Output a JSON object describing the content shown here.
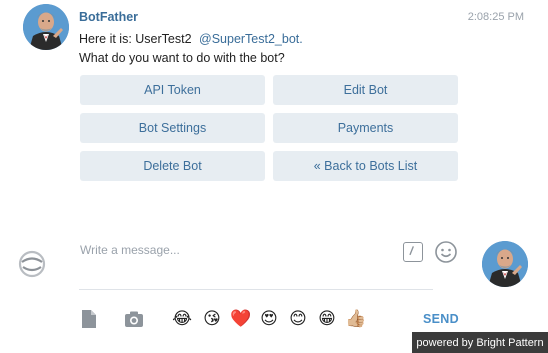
{
  "message": {
    "sender": "BotFather",
    "time": "2:08:25 PM",
    "line1_text": "Here it is: UserTest2",
    "line1_mention": "@SuperTest2_bot.",
    "line2_text": "What do you want to do with the bot?"
  },
  "keyboard": {
    "buttons": [
      "API Token",
      "Edit Bot",
      "Bot Settings",
      "Payments",
      "Delete Bot",
      "« Back to Bots List"
    ]
  },
  "composer": {
    "placeholder": "Write a message...",
    "send_label": "SEND",
    "emojis": [
      "😂",
      "😘",
      "❤️",
      "😍",
      "😊",
      "😁",
      "👍🏼"
    ]
  },
  "branding": {
    "powered_by": "powered by Bright Pattern"
  },
  "colors": {
    "accent": "#3d6f9b",
    "send": "#4a8fc8",
    "button_bg": "#e7edf2",
    "badge_bg": "#3b3b3b"
  },
  "icons": [
    "bot-avatar",
    "loading-spinner-icon",
    "slash-command-icon",
    "smile-icon",
    "user-avatar",
    "file-attach-icon",
    "camera-icon"
  ]
}
